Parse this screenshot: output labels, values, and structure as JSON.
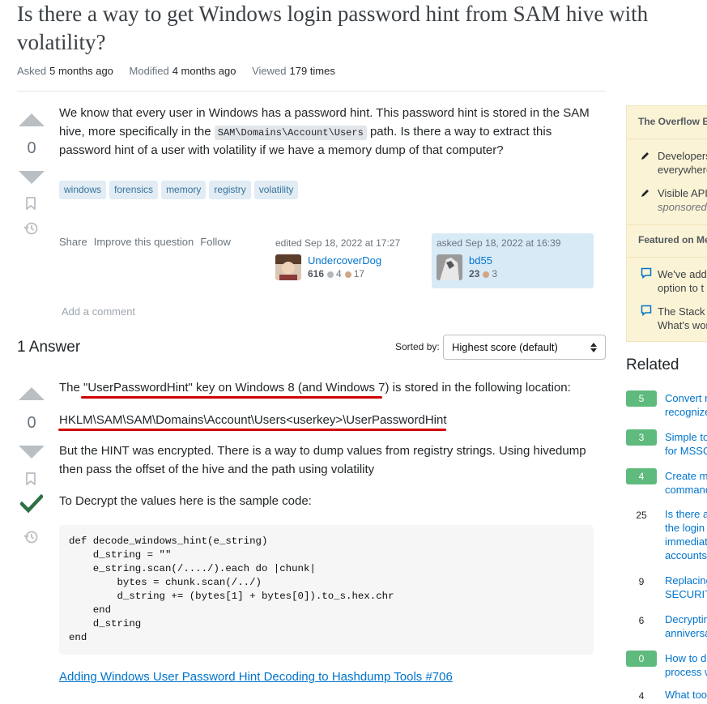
{
  "question": {
    "title": "Is there a way to get Windows login password hint from SAM hive with volatility?",
    "meta": {
      "asked_label": "Asked",
      "asked_value": "5 months ago",
      "modified_label": "Modified",
      "modified_value": "4 months ago",
      "viewed_label": "Viewed",
      "viewed_value": "179 times"
    },
    "votes": "0",
    "body_part1": "We know that every user in Windows has a password hint. This password hint is stored in the SAM hive, more specifically in the ",
    "body_code": "SAM\\Domains\\Account\\Users",
    "body_part2": " path. Is there a way to extract this password hint of a user with volatility if we have a memory dump of that computer?",
    "tags": [
      "windows",
      "forensics",
      "memory",
      "registry",
      "volatility"
    ],
    "menu": {
      "share": "Share",
      "improve": "Improve this question",
      "follow": "Follow"
    },
    "edited": {
      "when": "edited Sep 18, 2022 at 17:27",
      "user": "UndercoverDog",
      "rep": "616",
      "silver": "4",
      "bronze": "17"
    },
    "asked": {
      "when": "asked Sep 18, 2022 at 16:39",
      "user": "bd55",
      "rep": "23",
      "bronze": "3"
    },
    "add_comment": "Add a comment"
  },
  "answers_header": {
    "count_label": "1 Answer",
    "sorted_by": "Sorted by:",
    "sort_value": "Highest score (default)"
  },
  "answer": {
    "votes": "0",
    "line1": "The \"UserPasswordHint\" key on Windows 8 (and Windows 7) is stored in the following location:",
    "path": "HKLM\\SAM\\SAM\\Domains\\Account\\Users<userkey>\\UserPasswordHint",
    "para2": "But the HINT was encrypted. There is a way to dump values from registry strings. Using hivedump then pass the offset of the hive and the path using volatility",
    "para3": "To Decrypt the values here is the sample code:",
    "code": "def decode_windows_hint(e_string)\n    d_string = \"\"\n    e_string.scan(/..../).each do |chunk|\n        bytes = chunk.scan(/../)\n        d_string += (bytes[1] + bytes[0]).to_s.hex.chr\n    end\n    d_string\nend",
    "link": "Adding Windows User Password Hint Decoding to Hashdump Tools #706"
  },
  "sidebar": {
    "blog_header": "The Overflow B",
    "blog_items": [
      {
        "line1": "Developers",
        "line2": "everywhere"
      },
      {
        "line1": "Visible APIs",
        "line2": "sponsored p"
      }
    ],
    "meta_header": "Featured on Me",
    "meta_items": [
      {
        "line1": "We've adde",
        "line2": "option to t"
      },
      {
        "line1": "The Stack E",
        "line2": "What's wor"
      }
    ],
    "related_title": "Related",
    "related": [
      {
        "score": "5",
        "accepted": true,
        "line1": "Convert r",
        "line2": "recognize"
      },
      {
        "score": "3",
        "accepted": true,
        "line1": "Simple to",
        "line2": "for MSSQ"
      },
      {
        "score": "4",
        "accepted": true,
        "line1": "Create m",
        "line2": "command"
      },
      {
        "score": "25",
        "accepted": false,
        "line1": "Is there a",
        "line2": "the login",
        "line3": "immediat",
        "line4": "accounts."
      },
      {
        "score": "9",
        "accepted": false,
        "line1": "Replacing",
        "line2": "SECURITY"
      },
      {
        "score": "6",
        "accepted": false,
        "line1": "Decryptin",
        "line2": "anniversa"
      },
      {
        "score": "0",
        "accepted": true,
        "line1": "How to d",
        "line2": "process w"
      },
      {
        "score": "4",
        "accepted": false,
        "line1": "What too"
      }
    ]
  },
  "colors": {
    "accent": "#0074cc",
    "accepted": "#2f6f44",
    "underline": "#d00000",
    "tag_bg": "#e1ecf4"
  }
}
